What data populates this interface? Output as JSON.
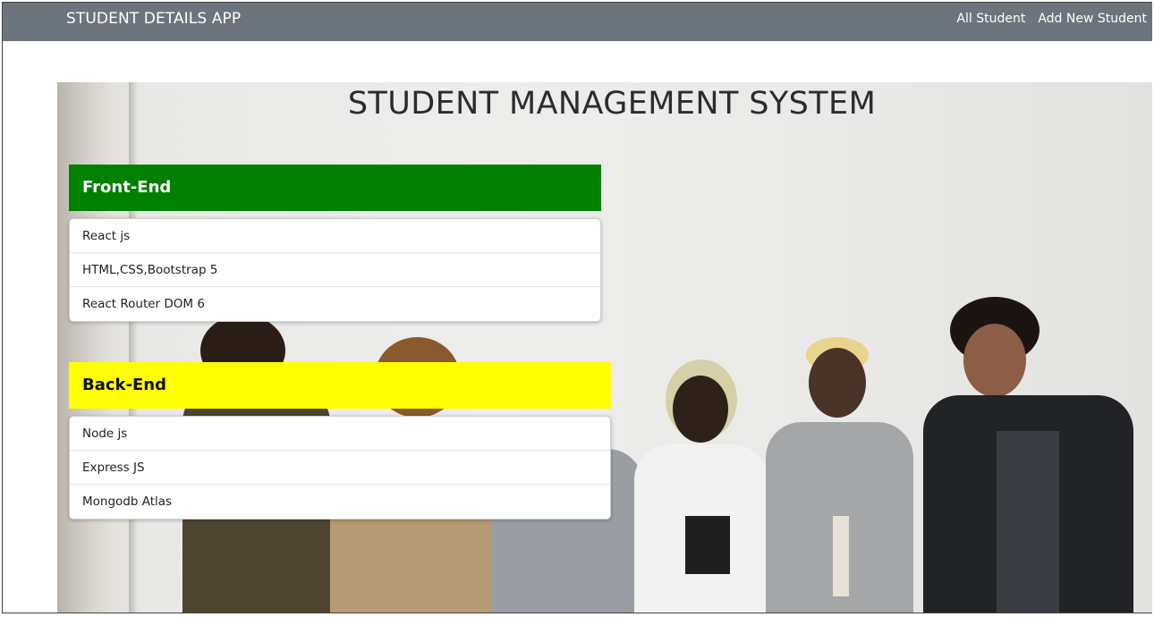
{
  "navbar": {
    "brand": "STUDENT DETAILS APP",
    "links": [
      "All Student",
      "Add New Student"
    ]
  },
  "hero": {
    "title": "STUDENT MANAGEMENT SYSTEM"
  },
  "frontend": {
    "header": "Front-End",
    "items": [
      "React js",
      "HTML,CSS,Bootstrap 5",
      "React Router DOM 6"
    ]
  },
  "backend": {
    "header": "Back-End",
    "items": [
      "Node js",
      "Express JS",
      "Mongodb Atlas"
    ]
  },
  "colors": {
    "navbar": "#6c757d",
    "frontend_header": "#008000",
    "backend_header": "#ffff00"
  }
}
